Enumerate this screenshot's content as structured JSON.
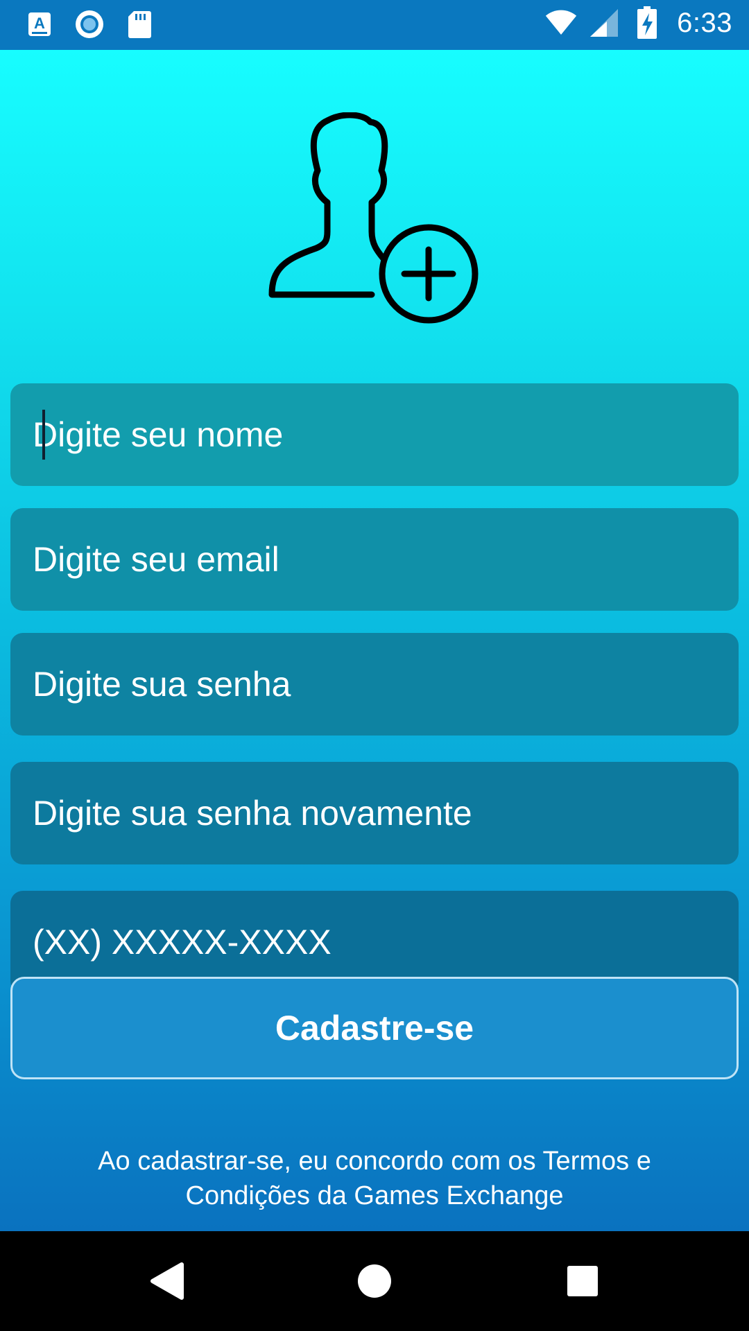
{
  "status_bar": {
    "time": "6:33",
    "left_icons": [
      "a-keyboard-icon",
      "record-icon",
      "sd-card-icon"
    ],
    "right_icons": [
      "wifi-icon",
      "cell-signal-icon",
      "battery-charging-icon"
    ]
  },
  "form": {
    "header_icon": "add-user-icon",
    "name_placeholder": "Digite seu nome",
    "email_placeholder": "Digite seu email",
    "password_placeholder": "Digite sua senha",
    "password_confirm_placeholder": "Digite sua senha novamente",
    "phone_placeholder": "(XX) XXXXX-XXXX",
    "register_label": "Cadastre-se",
    "terms_line1": "Ao cadastrar-se, eu concordo com os Termos e",
    "terms_line2": "Condições da Games Exchange"
  },
  "nav_bar": {
    "icons": [
      "back-icon",
      "home-icon",
      "recents-icon"
    ]
  },
  "colors": {
    "status_bar": "#0a78bf",
    "gradient_top": "#17fdff",
    "gradient_bottom": "#0a72bf",
    "field_1": "#129dad",
    "field_2": "#1090a8",
    "field_3": "#0e83a2",
    "field_4": "#0d7a9e",
    "field_5": "#0b6f98",
    "button": "#1b8fce",
    "button_border": "#bfe3f6"
  }
}
